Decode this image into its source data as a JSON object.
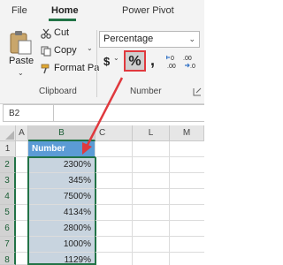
{
  "tabs": [
    "File",
    "Home",
    "Power Pivot"
  ],
  "clipboard": {
    "paste_label": "Paste",
    "cut_label": "Cut",
    "copy_label": "Copy",
    "format_painter_label": "Format Paint",
    "group_label": "Clipboard"
  },
  "number": {
    "format_value": "Percentage",
    "currency_symbol": "$",
    "percent_symbol": "%",
    "comma_symbol": ",",
    "group_label": "Number"
  },
  "name_box": "B2",
  "columns": [
    "A",
    "B",
    "C",
    "L",
    "M"
  ],
  "rows": [
    "1",
    "2",
    "3",
    "4",
    "5",
    "6",
    "7",
    "8"
  ],
  "table": {
    "header": "Number",
    "values": [
      "2300%",
      "345%",
      "7500%",
      "4134%",
      "2800%",
      "1000%",
      "1129%"
    ]
  },
  "colors": {
    "accent": "#217346",
    "highlight": "#e0393e",
    "header_fill": "#5b9bd5",
    "selection_fill": "#c8d4df"
  }
}
